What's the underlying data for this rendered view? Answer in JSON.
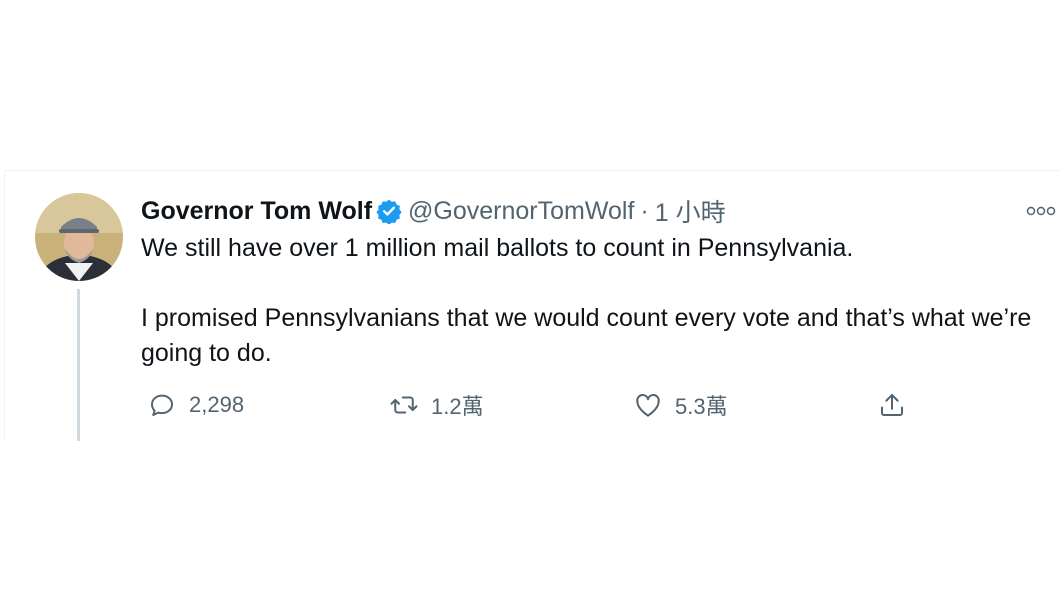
{
  "tweet": {
    "display_name": "Governor Tom Wolf",
    "handle": "@GovernorTomWolf",
    "separator": "·",
    "time": "1 小時",
    "text": "We still have over 1 million mail ballots to count in Pennsylvania.\n\nI promised Pennsylvanians that we would count every vote and that’s what we’re going to do.",
    "verified": true,
    "accent_color": "#1d9bf0"
  },
  "actions": {
    "reply_count": "2,298",
    "retweet_count": "1.2萬",
    "like_count": "5.3萬",
    "icons": [
      "reply-icon",
      "retweet-icon",
      "like-icon",
      "share-icon"
    ]
  },
  "menu": {
    "icon": "more-icon"
  }
}
